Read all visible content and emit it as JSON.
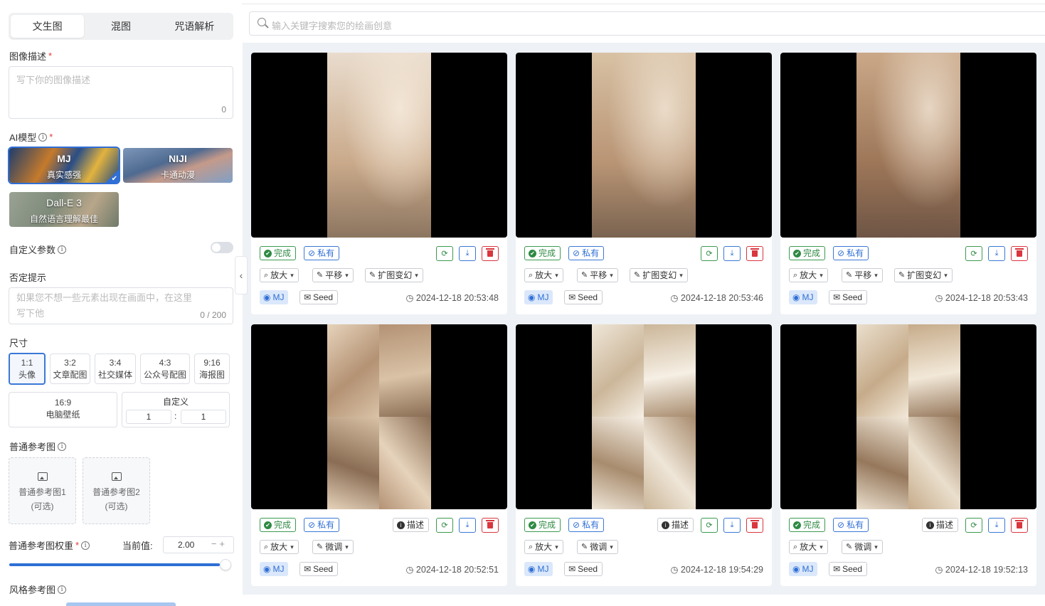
{
  "sidebar": {
    "tabs": [
      {
        "label": "文生图",
        "active": true
      },
      {
        "label": "混图",
        "active": false
      },
      {
        "label": "咒语解析",
        "active": false
      }
    ],
    "prompt": {
      "label": "图像描述",
      "required": "*",
      "placeholder": "写下你的图像描述",
      "count": "0"
    },
    "model": {
      "label": "AI模型",
      "required": "*",
      "options": [
        {
          "name": "MJ",
          "desc": "真实感强",
          "selected": true
        },
        {
          "name": "NIJI",
          "desc": "卡通动漫",
          "selected": false
        },
        {
          "name": "Dall-E 3",
          "desc": "自然语言理解最佳",
          "selected": false
        }
      ]
    },
    "custom_params": {
      "label": "自定义参数",
      "enabled": false
    },
    "negative": {
      "label": "否定提示",
      "placeholder_line1": "如果您不想一些元素出现在画面中，在这里",
      "placeholder_line2": "写下他",
      "count": "0 / 200"
    },
    "size": {
      "label": "尺寸",
      "options": [
        {
          "ratio": "1:1",
          "desc": "头像",
          "active": true
        },
        {
          "ratio": "3:2",
          "desc": "文章配图",
          "active": false
        },
        {
          "ratio": "3:4",
          "desc": "社交媒体",
          "active": false
        },
        {
          "ratio": "4:3",
          "desc": "公众号配图",
          "active": false
        },
        {
          "ratio": "9:16",
          "desc": "海报图",
          "active": false
        },
        {
          "ratio": "16:9",
          "desc": "电脑壁纸",
          "active": false
        }
      ],
      "custom": {
        "label": "自定义",
        "w": "1",
        "h": "1",
        "sep": ":"
      }
    },
    "ref": {
      "label": "普通参考图",
      "boxes": [
        {
          "line1": "普通参考图1",
          "line2": "(可选)"
        },
        {
          "line1": "普通参考图2",
          "line2": "(可选)"
        }
      ]
    },
    "weight": {
      "label": "普通参考图权重",
      "required": "*",
      "current_label": "当前值:",
      "value": "2.00",
      "slider_fraction": 1.0
    },
    "style_ref": {
      "label": "风格参考图"
    }
  },
  "search": {
    "placeholder": "输入关键字搜索您的绘画创意"
  },
  "cards": [
    {
      "status": "完成",
      "privacy": "私有",
      "describe": "",
      "actions": [
        "放大",
        "平移",
        "扩图变幻"
      ],
      "model": "MJ",
      "seed": "Seed",
      "time": "2024-12-18 20:53:48",
      "grid": false
    },
    {
      "status": "完成",
      "privacy": "私有",
      "describe": "",
      "actions": [
        "放大",
        "平移",
        "扩图变幻"
      ],
      "model": "MJ",
      "seed": "Seed",
      "time": "2024-12-18 20:53:46",
      "grid": false
    },
    {
      "status": "完成",
      "privacy": "私有",
      "describe": "",
      "actions": [
        "放大",
        "平移",
        "扩图变幻"
      ],
      "model": "MJ",
      "seed": "Seed",
      "time": "2024-12-18 20:53:43",
      "grid": false
    },
    {
      "status": "完成",
      "privacy": "私有",
      "describe": "描述",
      "actions": [
        "放大",
        "微调"
      ],
      "model": "MJ",
      "seed": "Seed",
      "time": "2024-12-18 20:52:51",
      "grid": true
    },
    {
      "status": "完成",
      "privacy": "私有",
      "describe": "描述",
      "actions": [
        "放大",
        "微调"
      ],
      "model": "MJ",
      "seed": "Seed",
      "time": "2024-12-18 19:54:29",
      "grid": true
    },
    {
      "status": "完成",
      "privacy": "私有",
      "describe": "描述",
      "actions": [
        "放大",
        "微调"
      ],
      "model": "MJ",
      "seed": "Seed",
      "time": "2024-12-18 19:52:13",
      "grid": true
    }
  ],
  "colors": {
    "accent": "#2f6fd6",
    "success": "#2f8a43",
    "danger": "#d9363e",
    "main_bg": "#eef1f5"
  }
}
